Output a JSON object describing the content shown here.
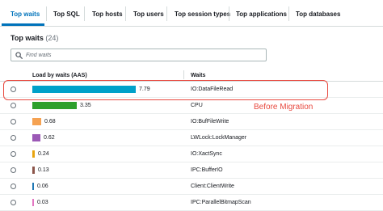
{
  "tabs": [
    {
      "label": "Top waits",
      "active": true
    },
    {
      "label": "Top SQL",
      "active": false
    },
    {
      "label": "Top hosts",
      "active": false
    },
    {
      "label": "Top users",
      "active": false
    },
    {
      "label": "Top session types",
      "active": false
    },
    {
      "label": "Top applications",
      "active": false
    },
    {
      "label": "Top databases",
      "active": false
    }
  ],
  "section": {
    "title": "Top waits",
    "count": "(24)"
  },
  "search": {
    "placeholder": "Find waits",
    "value": ""
  },
  "table": {
    "columns": [
      "Load by waits (AAS)",
      "Waits"
    ],
    "max_load": 7.79,
    "rows": [
      {
        "load": "7.79",
        "load_value": 7.79,
        "wait": "IO:DataFileRead",
        "color": "#00a1c9"
      },
      {
        "load": "3.35",
        "load_value": 3.35,
        "wait": "CPU",
        "color": "#2ea02c"
      },
      {
        "load": "0.68",
        "load_value": 0.68,
        "wait": "IO:BufFileWrite",
        "color": "#f5a252"
      },
      {
        "load": "0.62",
        "load_value": 0.62,
        "wait": "LWLock:LockManager",
        "color": "#9b59b6"
      },
      {
        "load": "0.24",
        "load_value": 0.24,
        "wait": "IO:XactSync",
        "color": "#e8a40f"
      },
      {
        "load": "0.13",
        "load_value": 0.13,
        "wait": "IPC:BufferIO",
        "color": "#8c564b"
      },
      {
        "load": "0.06",
        "load_value": 0.06,
        "wait": "Client:ClientWrite",
        "color": "#1f77b4"
      },
      {
        "load": "0.03",
        "load_value": 0.03,
        "wait": "IPC:ParallelBitmapScan",
        "color": "#e377c2"
      }
    ]
  },
  "annotation": {
    "text": "Before Migration",
    "color": "#e8493f"
  },
  "colors": {
    "accent": "#0073bb",
    "border": "#d5dbdb",
    "highlight": "#e8493f"
  }
}
